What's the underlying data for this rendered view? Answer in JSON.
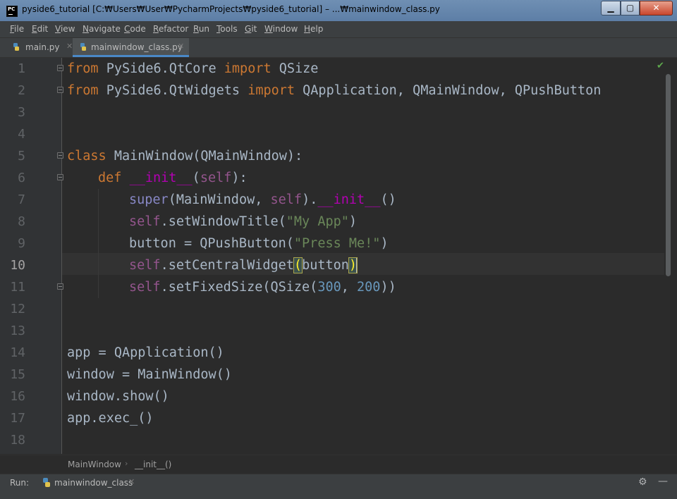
{
  "window": {
    "title": "pyside6_tutorial [C:₩Users₩User₩PycharmProjects₩pyside6_tutorial] – ...₩mainwindow_class.py",
    "controls": {
      "minimize": "▁",
      "maximize": "▢",
      "close": "✕"
    }
  },
  "menu": [
    {
      "u": "F",
      "rest": "ile"
    },
    {
      "u": "E",
      "rest": "dit"
    },
    {
      "u": "V",
      "rest": "iew"
    },
    {
      "u": "N",
      "rest": "avigate"
    },
    {
      "u": "C",
      "rest": "ode"
    },
    {
      "u": "R",
      "rest": "efactor"
    },
    {
      "u": "R",
      "rest": "un"
    },
    {
      "u": "T",
      "rest": "ools"
    },
    {
      "u": "G",
      "rest": "it"
    },
    {
      "u": "W",
      "rest": "indow"
    },
    {
      "u": "H",
      "rest": "elp"
    }
  ],
  "tabs": [
    {
      "label": "main.py",
      "active": false
    },
    {
      "label": "mainwindow_class.py",
      "active": true
    }
  ],
  "editor": {
    "current_line": 10,
    "line_numbers": [
      "1",
      "2",
      "3",
      "4",
      "5",
      "6",
      "7",
      "8",
      "9",
      "10",
      "11",
      "12",
      "13",
      "14",
      "15",
      "16",
      "17",
      "18"
    ],
    "lines": {
      "l1": {
        "t1": "from",
        "t2": " PySide6.QtCore ",
        "t3": "import",
        "t4": " QSize"
      },
      "l2": {
        "t1": "from",
        "t2": " PySide6.QtWidgets ",
        "t3": "import",
        "t4": " QApplication, QMainWindow, QPushButton"
      },
      "l5": {
        "t1": "class",
        "t2": " MainWindow(QMainWindow):"
      },
      "l6": {
        "t1": "def",
        "t2": " ",
        "t3": "__init__",
        "t4": "(",
        "t5": "self",
        "t6": "):"
      },
      "l7": {
        "t1": "super",
        "t2": "(MainWindow, ",
        "t3": "self",
        "t4": ").",
        "t5": "__init__",
        "t6": "()"
      },
      "l8": {
        "t1": "self",
        "t2": ".setWindowTitle(",
        "t3": "\"My App\"",
        "t4": ")"
      },
      "l9": {
        "t1": "button = QPushButton(",
        "t2": "\"Press Me!\"",
        "t3": ")"
      },
      "l10": {
        "t1": "self",
        "t2": ".setCentralWidget",
        "t3": "(",
        "t4": "button",
        "t5": ")"
      },
      "l11": {
        "t1": "self",
        "t2": ".setFixedSize(QSize(",
        "t3": "300",
        "t4": ", ",
        "t5": "200",
        "t6": "))"
      },
      "l14": "app = QApplication()",
      "l15": "window = MainWindow()",
      "l16": "window.show()",
      "l17": "app.exec_()"
    },
    "status_icon": "check-icon"
  },
  "breadcrumb": [
    "MainWindow",
    "__init__()"
  ],
  "run": {
    "label": "Run:",
    "tab": "mainwindow_class"
  },
  "colors": {
    "keyword": "#cc7832",
    "self": "#94558d",
    "string": "#6a8759",
    "number": "#6897bb",
    "dunder": "#b200b2",
    "builtin": "#8888c6",
    "text": "#a9b7c6",
    "background": "#2b2b2b"
  }
}
